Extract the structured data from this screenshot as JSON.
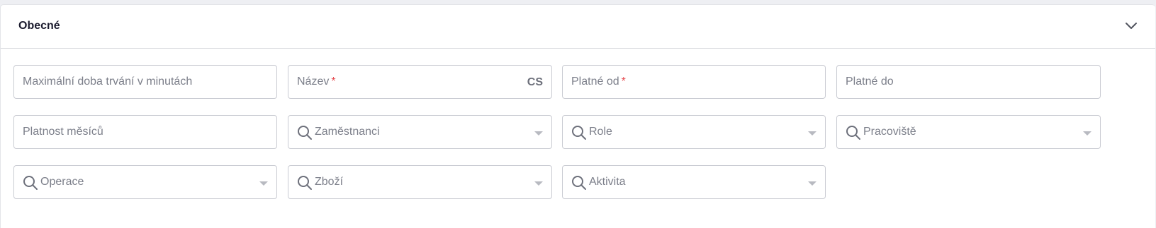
{
  "section": {
    "title": "Obecné"
  },
  "fields": {
    "max_duration": {
      "label": "Maximální doba trvání v minutách"
    },
    "name": {
      "label": "Název",
      "required_mark": "*",
      "lang": "CS"
    },
    "valid_from": {
      "label": "Platné od",
      "required_mark": "*"
    },
    "valid_to": {
      "label": "Platné do"
    },
    "validity_months": {
      "label": "Platnost měsíců"
    },
    "employees": {
      "label": "Zaměstnanci"
    },
    "role": {
      "label": "Role"
    },
    "workplace": {
      "label": "Pracoviště"
    },
    "operation": {
      "label": "Operace"
    },
    "goods": {
      "label": "Zboží"
    },
    "activity": {
      "label": "Aktivita"
    }
  },
  "icons": {
    "collapse": "chevron-down-icon",
    "search": "search-icon",
    "dropdown": "caret-down-icon"
  },
  "colors": {
    "required": "#e5484d",
    "label": "#7c7f8a",
    "border": "#c9cbd2"
  }
}
